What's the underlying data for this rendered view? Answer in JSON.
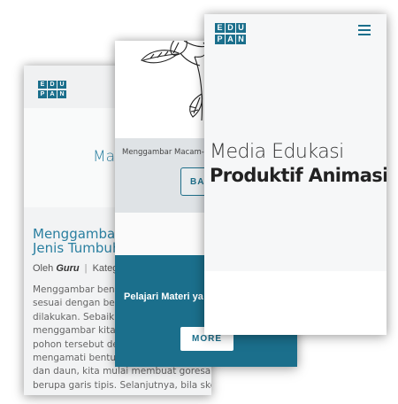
{
  "logo": {
    "letters_top": [
      "E",
      "D",
      "U"
    ],
    "letters_bottom": [
      "P",
      "A",
      "N"
    ],
    "color": "#1b6f8c"
  },
  "back_screen": {
    "hero_title": "Ma",
    "post_title_lines": [
      "Menggambar",
      "Jenis Tumbuh"
    ],
    "meta_prefix": "Oleh",
    "meta_author": "Guru",
    "meta_separator": "|",
    "meta_category": "Kateg",
    "body_lines": [
      "Menggambar bentu",
      "sesuai dengan bent",
      "dilakukan. Sebaikny",
      "menggambar kita p",
      "pohon tersebut der",
      "mengamati bentuk",
      "dan daun, kita mulai membuat goresan ber",
      "berupa garis tipis. Selanjutnya, bila sketsa"
    ]
  },
  "middle_screen": {
    "caption": "Menggambar Macam-m",
    "button_label": "BA",
    "teal_text": "Pelajari Materi ya",
    "more_button": "MORE",
    "accent": "#1b6f8c"
  },
  "front_screen": {
    "title_line1": "Media Edukasi",
    "title_line2": "Produktif Animasi.",
    "menu_icon": "hamburger-menu-icon"
  }
}
